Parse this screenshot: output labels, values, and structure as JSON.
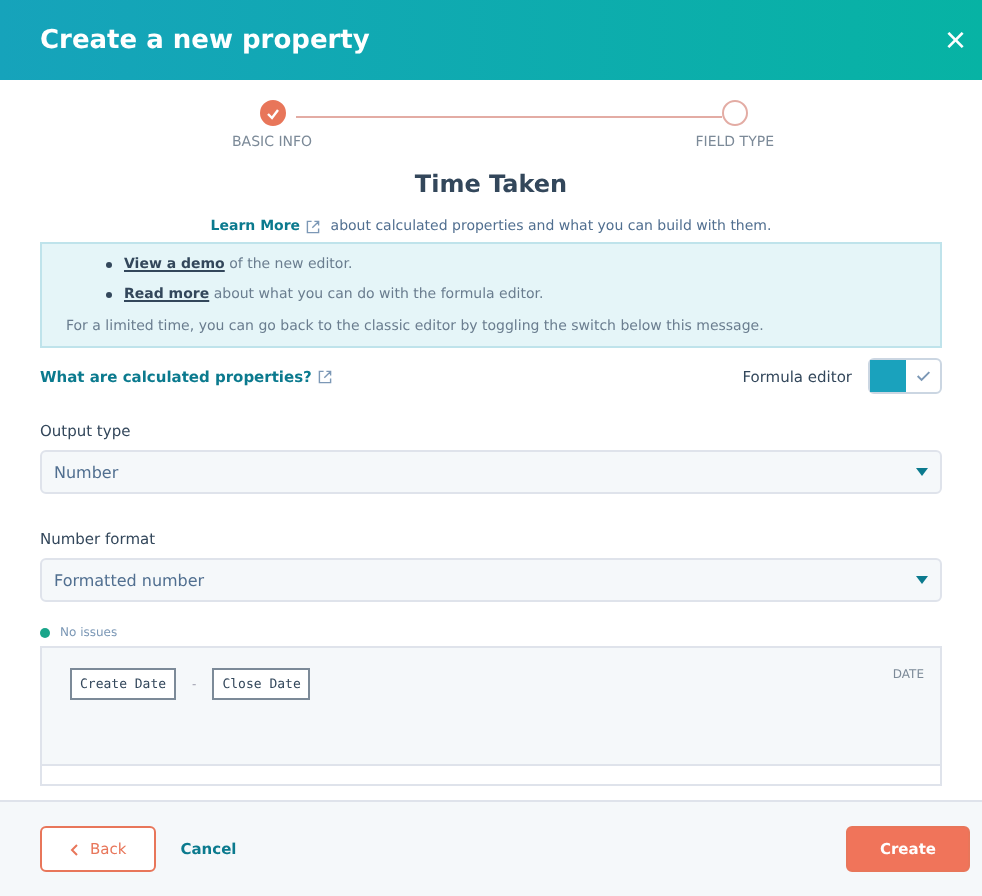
{
  "dialog": {
    "title": "Create a new property",
    "close": "×"
  },
  "steps": [
    {
      "label": "BASIC INFO",
      "completed": true
    },
    {
      "label": "FIELD TYPE",
      "completed": false
    }
  ],
  "heading": "Time Taken",
  "intro": {
    "link": "Learn More",
    "text": "about calculated properties and what you can build with them."
  },
  "notice": {
    "bullets": [
      {
        "link": "View a demo",
        "text": "of the new editor."
      },
      {
        "link": "Read more",
        "text": "about what you can do with the formula editor."
      }
    ],
    "footer": "For a limited time, you can go back to the classic editor by toggling the switch below this message."
  },
  "help_link": "What are calculated properties?",
  "formula_toggle": {
    "label": "Formula editor",
    "on": true
  },
  "fields": [
    {
      "label": "Output type",
      "value": "Number"
    },
    {
      "label": "Number format",
      "value": "Formatted number"
    }
  ],
  "status": {
    "text": "No issues",
    "color": "#1aa58a"
  },
  "formula": {
    "tokens": [
      "Create Date",
      "Close Date"
    ],
    "operator": "-",
    "type": "DATE"
  },
  "footer": {
    "back": "Back",
    "cancel": "Cancel",
    "create": "Create"
  }
}
